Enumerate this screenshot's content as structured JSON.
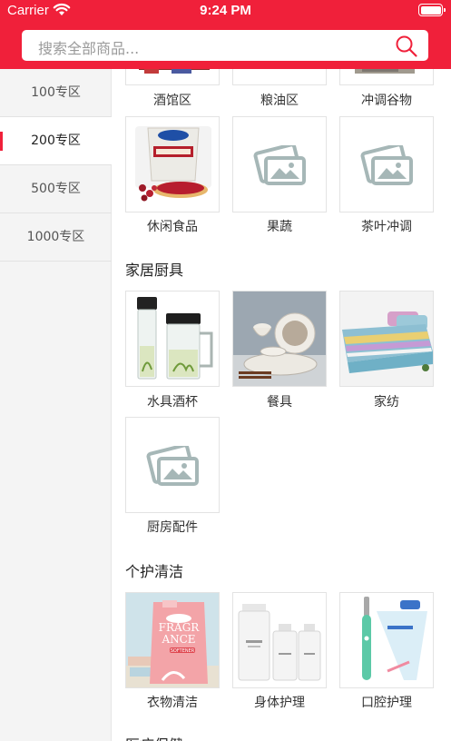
{
  "status_bar": {
    "carrier": "Carrier",
    "time": "9:24 PM"
  },
  "search": {
    "placeholder": "搜索全部商品..."
  },
  "sidebar": {
    "items": [
      {
        "label": "100专区",
        "active": false
      },
      {
        "label": "200专区",
        "active": true
      },
      {
        "label": "500专区",
        "active": false
      },
      {
        "label": "1000专区",
        "active": false
      }
    ]
  },
  "content": {
    "top_row": [
      {
        "label": "酒馆区",
        "image": "liquor-product-photo"
      },
      {
        "label": "粮油区",
        "image": "grain-oil-product-photo"
      },
      {
        "label": "冲调谷物",
        "image": "cereal-product-photo"
      }
    ],
    "row2": [
      {
        "label": "休闲食品",
        "image": "dried-cranberries-photo"
      },
      {
        "label": "果蔬",
        "image": "placeholder-image-icon"
      },
      {
        "label": "茶叶冲调",
        "image": "placeholder-image-icon"
      }
    ],
    "sections": [
      {
        "title": "家居厨具",
        "items": [
          {
            "label": "水具酒杯",
            "image": "glass-tumbler-photo"
          },
          {
            "label": "餐具",
            "image": "tableware-photo"
          },
          {
            "label": "家纺",
            "image": "bedding-photo"
          },
          {
            "label": "厨房配件",
            "image": "placeholder-image-icon"
          }
        ]
      },
      {
        "title": "个护清洁",
        "items": [
          {
            "label": "衣物清洁",
            "image": "laundry-detergent-photo",
            "product_text": [
              "FRAGR",
              "ANCE",
              "SOFTENER"
            ]
          },
          {
            "label": "身体护理",
            "image": "body-care-bottles-photo"
          },
          {
            "label": "口腔护理",
            "image": "toothbrush-toothpaste-photo"
          }
        ]
      },
      {
        "title": "医疗保健",
        "items": []
      }
    ]
  },
  "colors": {
    "brand_red": "#f0203a",
    "sidebar_bg": "#f4f4f4",
    "placeholder_gray": "#a6b7b7"
  }
}
